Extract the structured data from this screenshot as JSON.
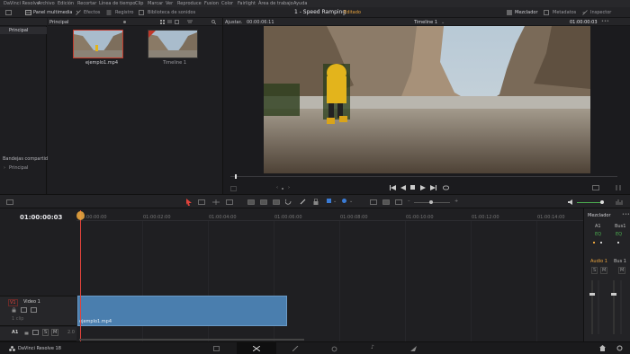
{
  "menu": [
    "DaVinci Resolve",
    "Archivo",
    "Edición",
    "Recortar",
    "Línea de tiempo",
    "Clip",
    "Marcar",
    "Ver",
    "Reproduce",
    "Fusion",
    "Color",
    "Fairlight",
    "Área de trabajo",
    "Ayuda"
  ],
  "toolbar": {
    "media_pool": "Panel multimedia",
    "effects": "Efectos",
    "index": "Registro",
    "sound_library": "Biblioteca de sonidos",
    "project_title": "1 - Speed Ramping",
    "project_status": "Editado",
    "mixer": "Mezclador",
    "metadata": "Metadatos",
    "inspector": "Inspector"
  },
  "bins": {
    "master": "Principal",
    "shared": "Bandejas compartidas",
    "shared_item": "Principal"
  },
  "media": {
    "header": "Principal",
    "clips": [
      {
        "name": "ejemplo1.mp4",
        "selected": true
      },
      {
        "name": "Timeline 1",
        "selected": false
      }
    ]
  },
  "viewer": {
    "zoom": "Ajustar",
    "source_tc": "00:00:06:11",
    "timeline_name": "Timeline 1",
    "tc": "01:00:00:03"
  },
  "timeline": {
    "tc": "01:00:00:03",
    "ruler": [
      "01:00:00:00",
      "01:00:02:00",
      "01:00:04:00",
      "01:00:06:00",
      "01:00:08:00",
      "01:00:10:00",
      "01:00:12:00",
      "01:00:14:00"
    ],
    "video_track": {
      "id": "V1",
      "name": "Video 1",
      "clips_label": "1 clip"
    },
    "audio_track": {
      "id": "A1",
      "gain": "2.0"
    },
    "clip_name": "ejemplo1.mp4"
  },
  "mixer_panel": {
    "title": "Mezclador",
    "channels": [
      "A1",
      "Bus1"
    ],
    "eq": "EQ",
    "labels": [
      "Audio 1",
      "Bus 1"
    ]
  },
  "app": {
    "name": "DaVinci Resolve 18"
  },
  "colors": {
    "accent": "#e8a33d",
    "playhead": "#e0433b",
    "clip": "#4a7eae",
    "selected": "#c0392b"
  }
}
